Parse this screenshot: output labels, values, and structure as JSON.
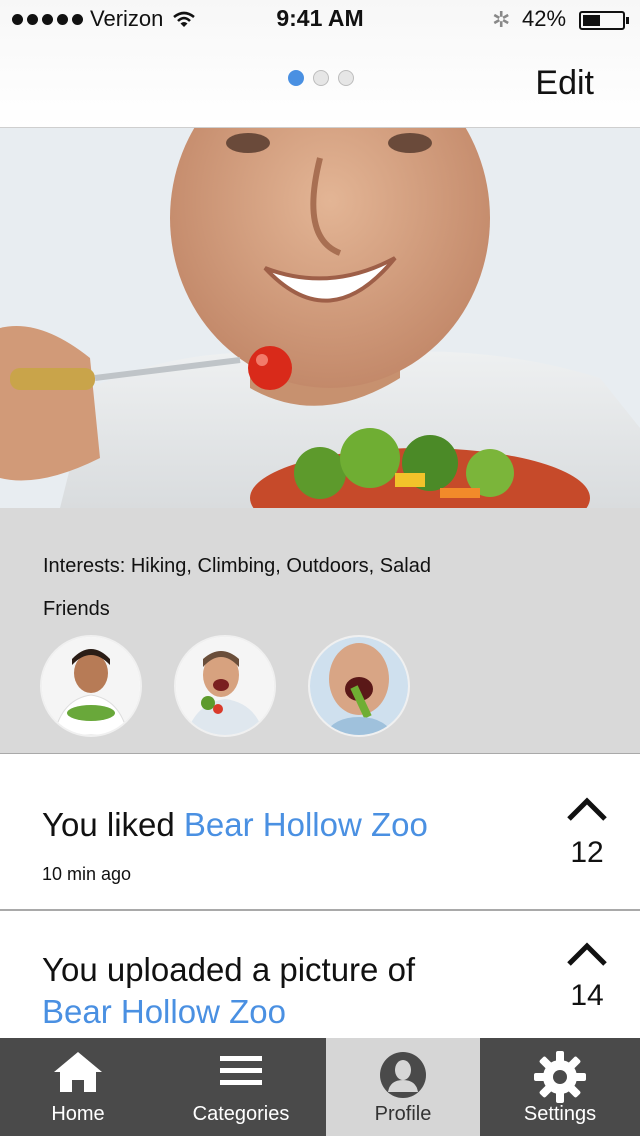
{
  "status_bar": {
    "carrier": "Verizon",
    "time": "9:41 AM",
    "battery": "42%",
    "signal_icon": "signal-dots-icon",
    "wifi_icon": "wifi-icon",
    "bluetooth_icon": "bluetooth-icon"
  },
  "nav": {
    "page_dots": {
      "count": 3,
      "active": 0
    },
    "edit_label": "Edit"
  },
  "profile": {
    "interests": "Interests: Hiking, Climbing, Outdoors, Salad",
    "friends_label": "Friends"
  },
  "feed": [
    {
      "actor": "You",
      "verb": " liked ",
      "place": "Bear Hollow Zoo",
      "time": "10 min ago",
      "count": "12"
    },
    {
      "actor": "You",
      "verb": " uploaded a picture of",
      "place": "Bear Hollow Zoo",
      "count": "14"
    }
  ],
  "tabs": [
    {
      "label": "Home",
      "icon": "home-icon"
    },
    {
      "label": "Categories",
      "icon": "menu-icon"
    },
    {
      "label": "Profile",
      "icon": "profile-icon",
      "selected": true
    },
    {
      "label": "Settings",
      "icon": "gear-icon"
    }
  ],
  "colors": {
    "accent": "#4a90e2",
    "tabbar": "#4a4a4a",
    "tab_selected": "#d6d6d6",
    "panel": "#d9d9d9"
  }
}
